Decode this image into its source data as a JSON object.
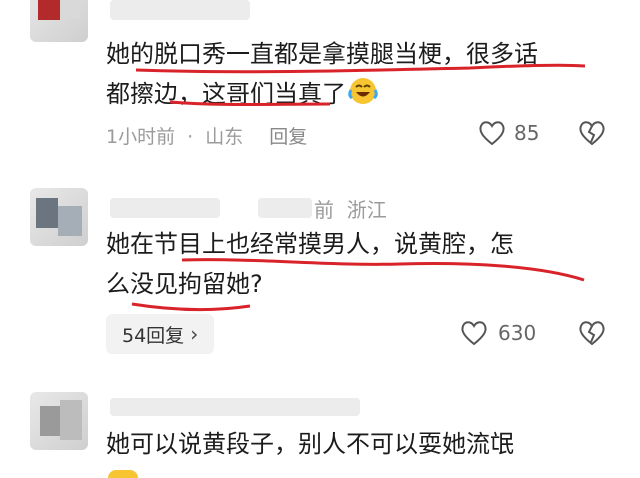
{
  "comments": [
    {
      "body_line1": "她的脱口秀一直都是拿摸腿当梗，很多话",
      "body_line2": "都擦边，这哥们当真了",
      "time": "1小时前",
      "separator": "·",
      "location": "山东",
      "reply_label": "回复",
      "likes": "85"
    },
    {
      "header_suffix": "前  浙江",
      "body_line1": "她在节目上也经常摸男人，说黄腔，怎",
      "body_line2": "么没见拘留她?",
      "replies_label": "54回复",
      "replies_chevron": "›",
      "likes": "630"
    },
    {
      "body_line1": "她可以说黄段子，别人不可以耍她流氓"
    }
  ],
  "colors": {
    "underline": "#d8232a",
    "meta": "#9b9b9b",
    "text": "#1c1c1c"
  },
  "icons": [
    "heart-icon",
    "broken-heart-icon",
    "laughing-crying-emoji-icon",
    "chevron-right-icon"
  ]
}
